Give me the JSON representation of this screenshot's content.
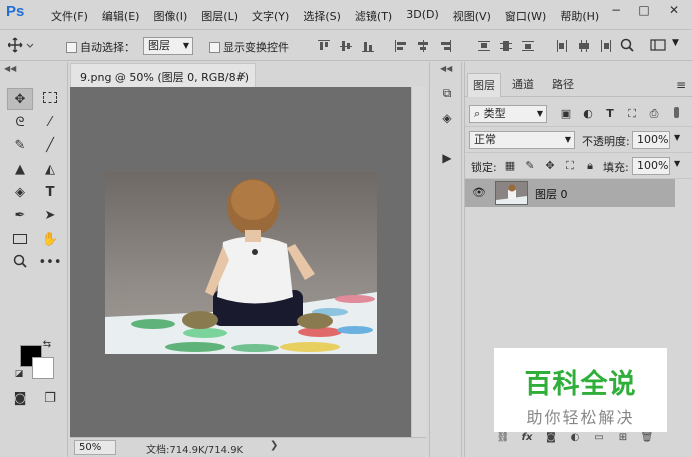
{
  "app": {
    "logo": "Ps"
  },
  "menu": [
    "文件(F)",
    "编辑(E)",
    "图像(I)",
    "图层(L)",
    "文字(Y)",
    "选择(S)",
    "滤镜(T)",
    "3D(D)",
    "视图(V)",
    "窗口(W)",
    "帮助(H)"
  ],
  "window_controls": {
    "minimize": "−",
    "maximize": "□",
    "close": "✕"
  },
  "options": {
    "auto_select_label": "自动选择：",
    "auto_select_value": "图层",
    "show_transform_label": "显示变换控件"
  },
  "document": {
    "tab_title": "9.png @ 50% (图层 0, RGB/8#)",
    "tab_close": "×",
    "zoom": "50%",
    "info": "文档:714.9K/714.9K",
    "info_arrow": "❯"
  },
  "layers_panel": {
    "tabs": [
      "图层",
      "通道",
      "路径"
    ],
    "filter_kind": "类型",
    "blend_mode": "正常",
    "opacity_label": "不透明度:",
    "opacity_value": "100%",
    "lock_label": "锁定:",
    "fill_label": "填充:",
    "fill_value": "100%",
    "layers": [
      {
        "name": "图层 0",
        "visible": true
      }
    ]
  },
  "watermark": {
    "title": "百科全说",
    "subtitle": "助你轻松解决"
  },
  "icons": [
    "move-icon",
    "marquee-icon",
    "lasso-icon",
    "magic-wand-icon",
    "eyedropper-icon",
    "brush-icon",
    "stamp-icon",
    "eraser-icon",
    "bucket-icon",
    "type-icon",
    "pen-icon",
    "select-arrow-icon",
    "rectangle-icon",
    "hand-icon",
    "zoom-icon",
    "more-icon"
  ],
  "colors": {
    "accent": "#1f6fd6",
    "watermark_green": "#2fae3a",
    "canvas_bg": "#6d6d6d"
  }
}
